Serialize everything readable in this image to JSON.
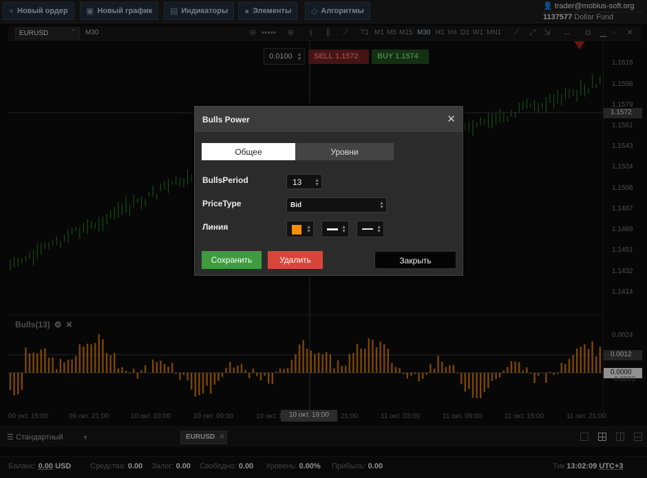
{
  "toolbar": {
    "new_order": "Новый ордер",
    "new_chart": "Новый график",
    "indicators": "Индикаторы",
    "elements": "Элементы",
    "algorithms": "Алгоритмы"
  },
  "account": {
    "email": "trader@mobius-soft.org",
    "number": "1137577",
    "name": "Dollar Fund"
  },
  "chart": {
    "symbol": "EURUSD",
    "timeframe": "M30",
    "timeframes": [
      "T1",
      "M1",
      "M5",
      "M15",
      "M30",
      "H1",
      "H4",
      "D1",
      "W1",
      "MN1"
    ],
    "active_timeframe": "M30",
    "lot": "0.0100",
    "sell_label": "SELL 1.1572",
    "buy_label": "BUY 1.1574",
    "price_ticks": [
      "1.1616",
      "1.1598",
      "1.1579",
      "1.1561",
      "1.1543",
      "1.1524",
      "1.1506",
      "1.1487",
      "1.1469",
      "1.1451",
      "1.1432",
      "1.1414"
    ],
    "current_price": "1.1572",
    "ind_ticks": [
      "0.0024",
      "-0.0003"
    ],
    "ind_current": "0.0012",
    "ind_zero": "0.0000",
    "time_ticks": [
      "09 окт. 15:00",
      "09 окт. 21:00",
      "10 окт. 03:00",
      "10 окт. 09:00",
      "10 окт. 15:00",
      "10 окт. 21:00",
      "11 окт. 03:00",
      "11 окт. 09:00",
      "11 окт. 15:00",
      "11 окт. 21:00"
    ],
    "crosshair_time": "10 окт. 19:00",
    "indicator_title": "Bulls(13)",
    "line_color": "#ff8c00",
    "candle_color": "#2a8a2a"
  },
  "bottom": {
    "layout_name": "Стандартный",
    "symbol_tab": "EURUSD"
  },
  "status": {
    "balance_label": "Баланс:",
    "balance_value": "0.00",
    "balance_currency": "USD",
    "equity_label": "Средства:",
    "equity_value": "0.00",
    "margin_label": "Залог:",
    "margin_value": "0.00",
    "free_label": "Свободно:",
    "free_value": "0.00",
    "level_label": "Уровень:",
    "level_value": "0.00%",
    "profit_label": "Прибыль:",
    "profit_value": "0.00",
    "tick_label": "Тик",
    "tick_time": "13:02:09",
    "tz": "UTC+3"
  },
  "dialog": {
    "title": "Bulls Power",
    "tab_general": "Общее",
    "tab_levels": "Уровни",
    "period_label": "BullsPeriod",
    "period_value": "13",
    "pricetype_label": "PriceType",
    "pricetype_value": "Bid",
    "line_label": "Линия",
    "save": "Сохранить",
    "delete": "Удалить",
    "close": "Закрыть"
  }
}
